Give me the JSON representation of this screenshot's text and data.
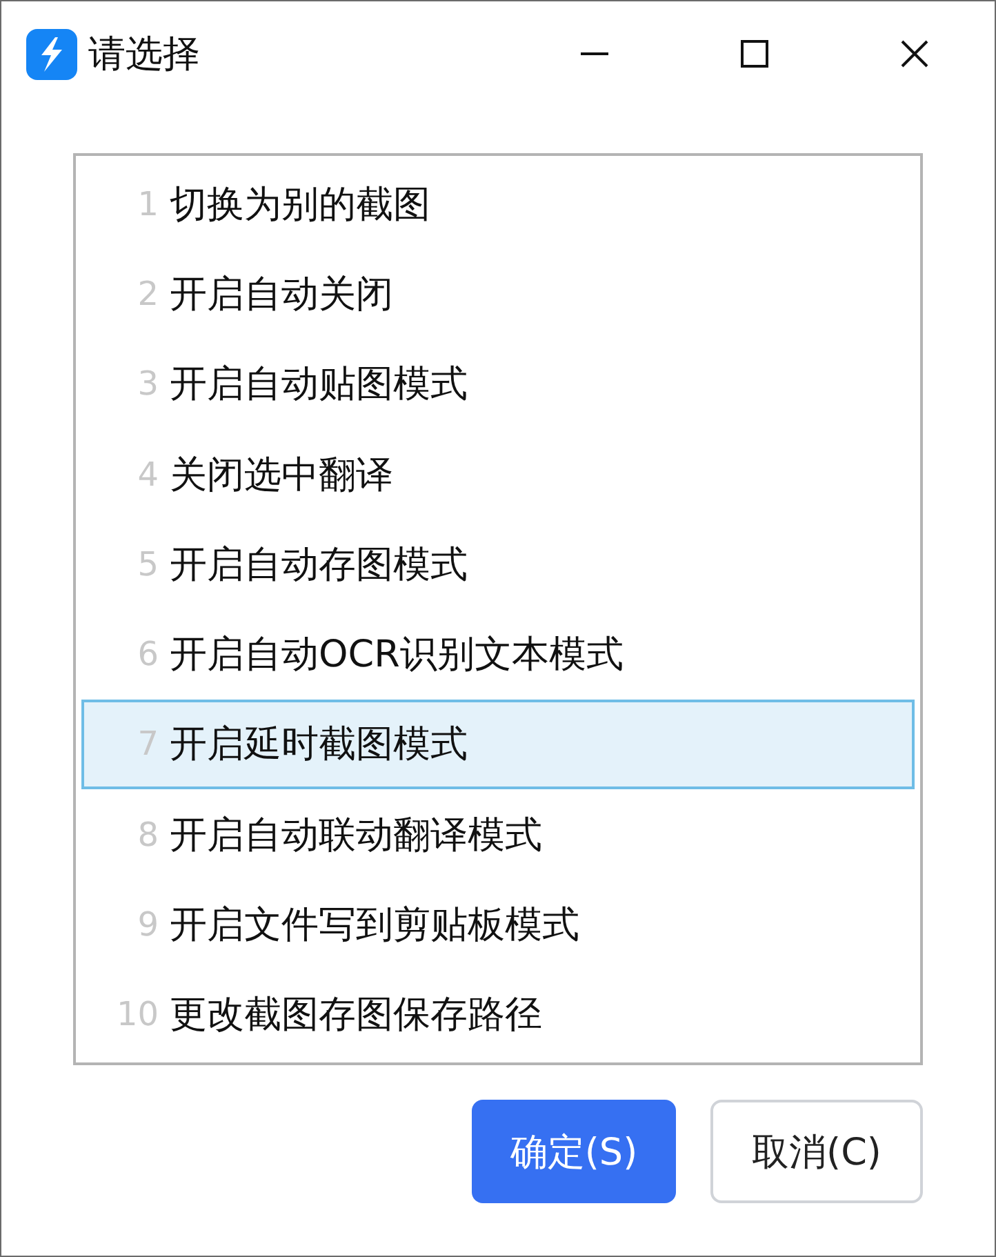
{
  "window": {
    "title": "请选择"
  },
  "items": [
    {
      "number": "1",
      "label": "切换为别的截图",
      "selected": false
    },
    {
      "number": "2",
      "label": "开启自动关闭",
      "selected": false
    },
    {
      "number": "3",
      "label": "开启自动贴图模式",
      "selected": false
    },
    {
      "number": "4",
      "label": "关闭选中翻译",
      "selected": false
    },
    {
      "number": "5",
      "label": "开启自动存图模式",
      "selected": false
    },
    {
      "number": "6",
      "label": "开启自动OCR识别文本模式",
      "selected": false
    },
    {
      "number": "7",
      "label": "开启延时截图模式",
      "selected": true
    },
    {
      "number": "8",
      "label": "开启自动联动翻译模式",
      "selected": false
    },
    {
      "number": "9",
      "label": "开启文件写到剪贴板模式",
      "selected": false
    },
    {
      "number": "10",
      "label": "更改截图存图保存路径",
      "selected": false
    }
  ],
  "buttons": [
    {
      "label": "确定(S)",
      "kind": "primary"
    },
    {
      "label": "取消(C)",
      "kind": "secondary"
    }
  ]
}
